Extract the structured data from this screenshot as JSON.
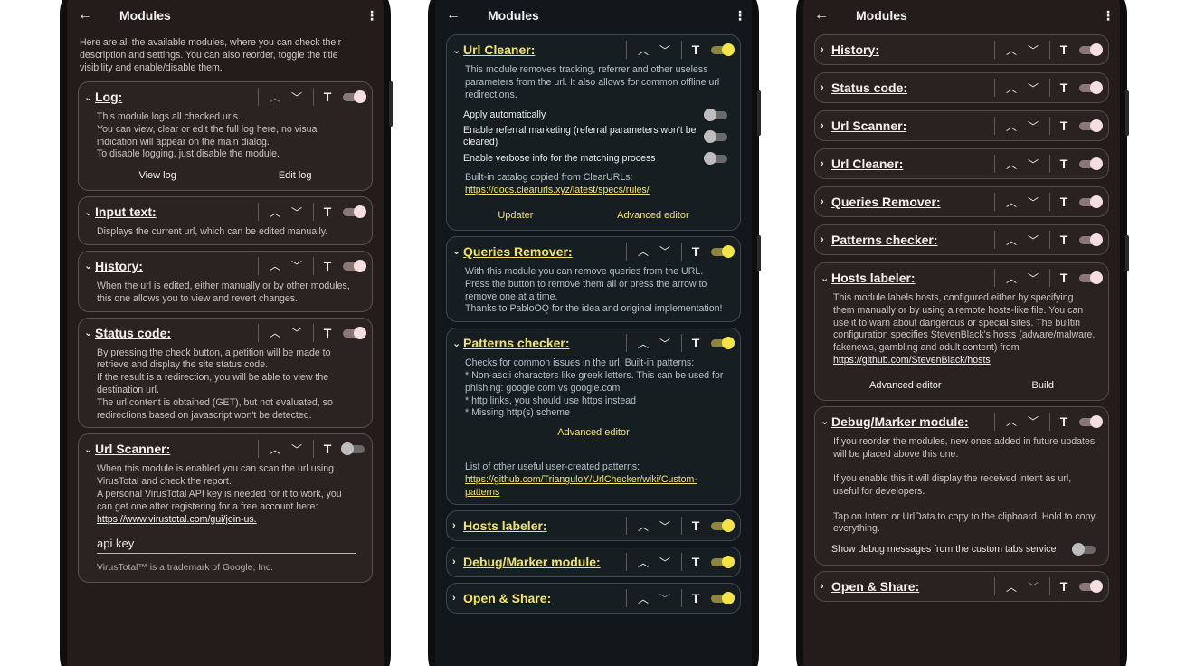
{
  "app": {
    "title": "Modules"
  },
  "phone1": {
    "intro": "Here are all the available modules, where you can check their description and settings. You can also reorder, toggle the title visibility and enable/disable them.",
    "log": {
      "name": "Log:",
      "desc": "This module logs all checked urls.\nYou can view, clear or edit the full log here, no visual indication will appear on the main dialog.\nTo disable logging, just disable the module.",
      "view": "View log",
      "edit": "Edit log"
    },
    "input": {
      "name": "Input text:",
      "desc": "Displays the current url, which can be edited manually."
    },
    "history": {
      "name": "History:",
      "desc": "When the url is edited, either manually or by other modules, this one allows you to view and revert changes."
    },
    "status": {
      "name": "Status code:",
      "desc": "By pressing the check button, a petition will be made to retrieve and display the site status code.\nIf the result is a redirection, you will be able to view the destination url.\nThe url content is obtained (GET), but not evaluated, so redirections based on javascript won't be detected."
    },
    "scanner": {
      "name": "Url Scanner:",
      "desc": "When this module is enabled you can scan the url using VirusTotal and check the report.\nA personal VirusTotal API key is needed for it to work, you can get one after registering for a free account here:",
      "link": "https://www.virustotal.com/gui/join-us.",
      "api_placeholder": "api key",
      "trademark": "VirusTotal™ is a trademark of Google, Inc."
    }
  },
  "phone2": {
    "cleaner": {
      "name": "Url Cleaner:",
      "desc": "This module removes tracking, referrer and other useless parameters from the url. It also allows for common offline url redirections.",
      "opt1": "Apply automatically",
      "opt2": "Enable referral marketing (referral parameters won't be cleared)",
      "opt3": "Enable verbose info for the matching process",
      "catalog": "Built-in catalog copied from ClearURLs:",
      "catalog_link": "https://docs.clearurls.xyz/latest/specs/rules/",
      "updater": "Updater",
      "advanced": "Advanced editor"
    },
    "queries": {
      "name": "Queries Remover:",
      "desc": "With this module you can remove queries from the URL. Press the button to remove them all or press the arrow to remove one at a time.\nThanks to PabloOQ for the idea and original implementation!"
    },
    "patterns": {
      "name": "Patterns checker:",
      "desc": "Checks for common issues in the url. Built-in patterns:\n* Non-ascii characters like greek letters. This can be used for phishing: google.com vs google.com\n* http links, you should use https instead\n* Missing http(s) scheme",
      "advanced": "Advanced editor",
      "other": "List of other useful user-created patterns:",
      "other_link": "https://github.com/TrianguloY/UrlChecker/wiki/Custom-patterns"
    },
    "hosts": {
      "name": "Hosts labeler:"
    },
    "debug": {
      "name": "Debug/Marker module:"
    },
    "open": {
      "name": "Open & Share:"
    }
  },
  "phone3": {
    "history": {
      "name": "History:"
    },
    "status": {
      "name": "Status code:"
    },
    "scanner": {
      "name": "Url Scanner:"
    },
    "cleaner": {
      "name": "Url Cleaner:"
    },
    "queries": {
      "name": "Queries Remover:"
    },
    "patterns": {
      "name": "Patterns checker:"
    },
    "hosts": {
      "name": "Hosts labeler:",
      "desc": "This module labels hosts, configured either by specifying them manually or by using a remote hosts-like file. You can use it to warn about dangerous or special sites. The builtin configuration specifies StevenBlack's hosts (adware/malware, fakenews, gambling and adult content) from",
      "link": "https://github.com/StevenBlack/hosts",
      "advanced": "Advanced editor",
      "build": "Build"
    },
    "debug": {
      "name": "Debug/Marker module:",
      "desc": "If you reorder the modules, new ones added in future updates will be placed above this one.\n\nIf you enable this it will display the received intent as url, useful for developers.\n\nTap on Intent or UrlData to copy to the clipboard. Hold to copy everything.",
      "opt": "Show debug messages from the custom tabs service"
    },
    "open": {
      "name": "Open & Share:"
    }
  },
  "icons": {
    "back": "arrow-back-icon",
    "menu": "more-vert-icon",
    "up": "chevron-up-icon",
    "down": "chevron-down-icon",
    "title_toggle": "T"
  },
  "colors": {
    "p1_bg": "#241c1b",
    "p2_bg": "#11171a",
    "p2_accent": "#f3e548",
    "p3_bg": "#241b1b"
  }
}
